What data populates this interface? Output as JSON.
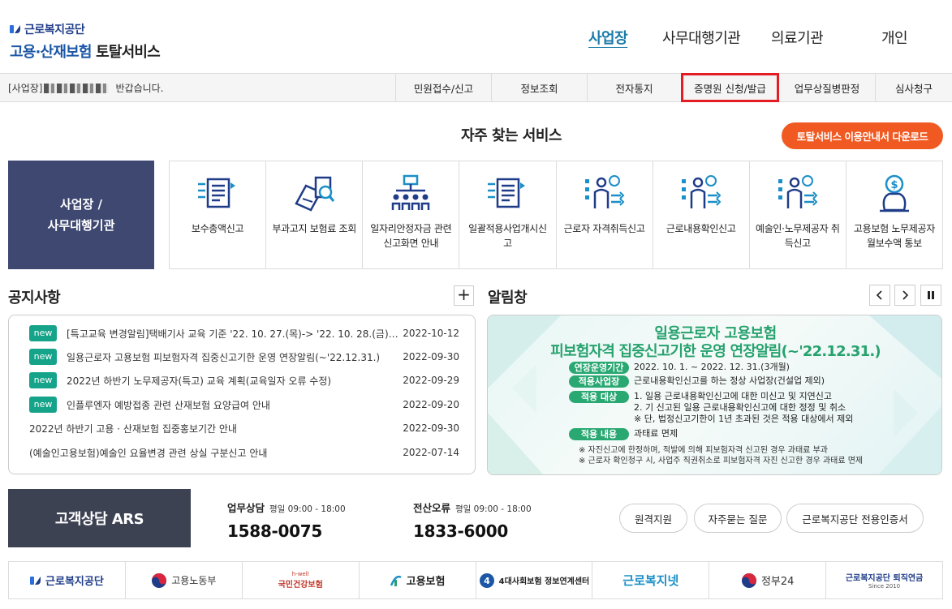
{
  "header": {
    "logo_top": "근로복지공단",
    "logo_bottom_a": "고용·산재보험",
    "logo_bottom_b": "토탈서비스",
    "gnb": [
      {
        "label": "사업장",
        "active": true
      },
      {
        "label": "사무대행기관",
        "active": false
      },
      {
        "label": "의료기관",
        "active": false
      },
      {
        "label": "개인",
        "active": false
      }
    ]
  },
  "topbar": {
    "greet_prefix": "[사업장]",
    "greet_suffix": "반갑습니다.",
    "menu": [
      "민원접수/신고",
      "정보조회",
      "전자통지",
      "증명원 신청/발급",
      "업무상질병판정",
      "심사청구"
    ]
  },
  "services": {
    "title": "자주 찾는 서비스",
    "guide_button": "토탈서비스 이용안내서 다운로드",
    "panel_line1": "사업장 /",
    "panel_line2": "사무대행기관",
    "items": [
      {
        "label": "보수총액신고",
        "icon": "document-list-icon"
      },
      {
        "label": "부과고지 보험료 조회",
        "icon": "search-document-icon"
      },
      {
        "label": "일자리안정자금 관련 신고화면 안내",
        "icon": "organization-icon"
      },
      {
        "label": "일괄적용사업개시신고",
        "icon": "document-list-icon"
      },
      {
        "label": "근로자 자격취득신고",
        "icon": "worker-icon"
      },
      {
        "label": "근로내용확인신고",
        "icon": "worker-icon"
      },
      {
        "label": "예술인·노무제공자 취득신고",
        "icon": "worker-icon"
      },
      {
        "label": "고용보험 노무제공자 월보수액 통보",
        "icon": "money-bag-icon"
      }
    ]
  },
  "notice": {
    "title": "공지사항",
    "more": "+",
    "badge": "new",
    "items": [
      {
        "title": "[특고교육 변경알림]택배기사 교육 기준 '22. 10. 27.(목)-> '22. 10. 28.(금) 14:...",
        "date": "2022-10-12",
        "new": true
      },
      {
        "title": "일용근로자 고용보험 피보험자격 집중신고기한 운영 연장알림(~'22.12.31.)",
        "date": "2022-09-30",
        "new": true
      },
      {
        "title": "2022년 하반기 노무제공자(특고) 교육 계획(교육일자 오류 수정)",
        "date": "2022-09-29",
        "new": true
      },
      {
        "title": "인플루엔자 예방접종 관련 산재보험 요양급여 안내",
        "date": "2022-09-20",
        "new": true
      },
      {
        "title": "2022년 하반기 고용 · 산재보험 집중홍보기간 안내",
        "date": "2022-09-30",
        "new": false
      },
      {
        "title": "(예술인고용보험)예술인 요율변경 관련 상실 구분신고 안내",
        "date": "2022-07-14",
        "new": false
      }
    ]
  },
  "alarm": {
    "title": "알림창",
    "banner_line1": "일용근로자 고용보험",
    "banner_line2": "피보험자격 집중신고기한 운영 연장알림(~'22.12.31.)",
    "rows": [
      {
        "tag": "연장운영기간",
        "lines": [
          "2022. 10. 1. ~ 2022. 12. 31.(3개월)"
        ]
      },
      {
        "tag": "적용사업장",
        "lines": [
          "근로내용확인신고를 하는 정상 사업장(건설업 제외)"
        ]
      },
      {
        "tag": "적용 대상",
        "lines": [
          "1. 일용 근로내용확인신고에 대한 미신고 및 지연신고",
          "2. 기 신고된 일용 근로내용확인신고에 대한 정정 및 취소",
          "※ 단, 법정신고기한이 1년 초과된 것은 적용 대상에서 제외"
        ]
      },
      {
        "tag": "적용 내용",
        "lines": [
          "과태료 면제"
        ]
      }
    ],
    "notes": [
      "※ 자진신고에 한정하며, 적발에 의해 피보험자격 신고된 경우 과태료 부과",
      "※ 근로자 확인청구 시, 사업주 직권취소로 피보험자격 자진 신고한 경우 과태료 면제"
    ]
  },
  "contact": {
    "ars": "고객상담 ARS",
    "work_label": "업무상담",
    "work_hours": "평일 09:00 - 18:00",
    "work_number": "1588-0075",
    "error_label": "전산오류",
    "error_hours": "평일 09:00 - 18:00",
    "error_number": "1833-6000",
    "buttons": [
      "원격지원",
      "자주묻는 질문",
      "근로복지공단 전용인증서"
    ]
  },
  "footer": {
    "logos": [
      {
        "text": "근로복지공단",
        "sub": ""
      },
      {
        "text": "고용노동부",
        "sub": ""
      },
      {
        "text": "국민건강보험",
        "sub": "h-well"
      },
      {
        "text": "고용보험",
        "sub": "EMPLOYMENT INSURANCE"
      },
      {
        "text": "4대사회보험 정보연계센터",
        "sub": ""
      },
      {
        "text": "근로복지넷",
        "sub": ""
      },
      {
        "text": "정부24",
        "sub": ""
      },
      {
        "text": "근로복지공단 퇴직연금",
        "sub": "Since 2010"
      }
    ]
  },
  "colors": {
    "accent": "#1a7ba8",
    "orange": "#f05a22",
    "navy": "#3e4871",
    "green": "#15a38a",
    "highlight": "#e41c24"
  }
}
